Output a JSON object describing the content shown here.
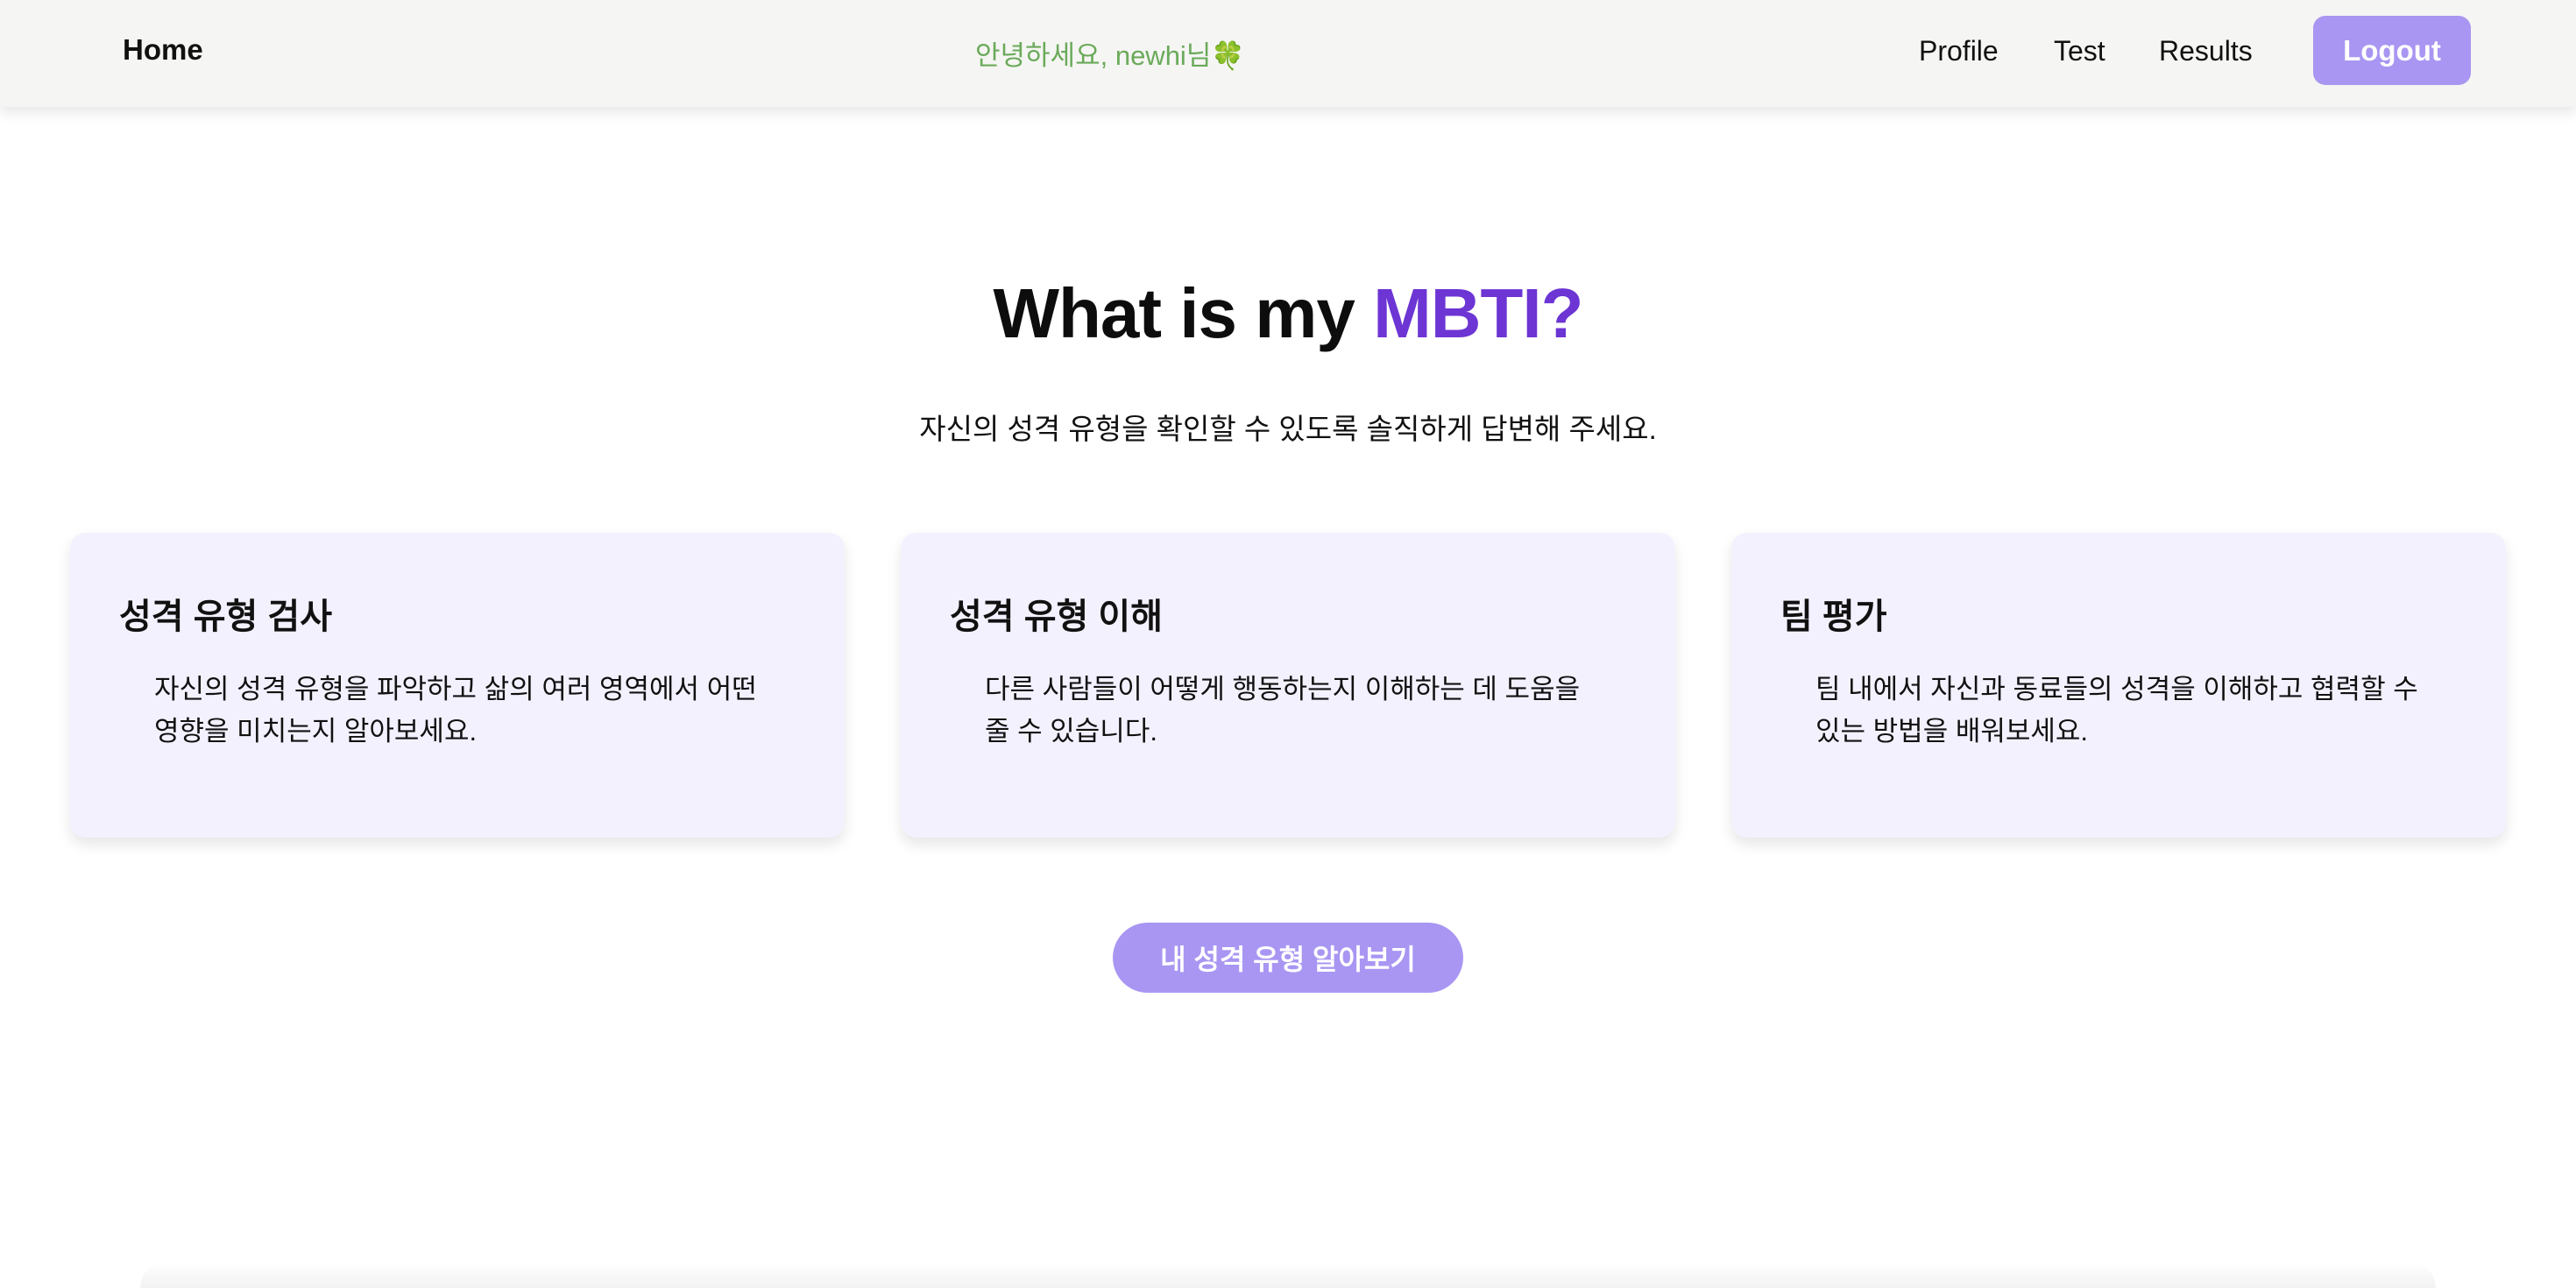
{
  "nav": {
    "home_label": "Home",
    "greeting": "안녕하세요, newhi님🍀",
    "links": [
      "Profile",
      "Test",
      "Results"
    ],
    "logout_label": "Logout"
  },
  "hero": {
    "title_prefix": "What is my ",
    "title_accent": "MBTI?",
    "subtitle": "자신의 성격 유형을 확인할 수 있도록 솔직하게 답변해 주세요."
  },
  "cards": [
    {
      "title": "성격 유형 검사",
      "description": "자신의 성격 유형을 파악하고 삶의 여러 영역에서 어떤 영향을 미치는지 알아보세요."
    },
    {
      "title": "성격 유형 이해",
      "description": "다른 사람들이 어떻게 행동하는지 이해하는 데 도움을 줄 수 있습니다."
    },
    {
      "title": "팀 평가",
      "description": "팀 내에서 자신과 동료들의 성격을 이해하고 협력할 수 있는 방법을 배워보세요."
    }
  ],
  "cta": {
    "label": "내 성격 유형 알아보기"
  },
  "colors": {
    "accent": "#6c35d4",
    "button": "#a996f2",
    "greeting": "#6aaa5a",
    "navbar_bg": "#f5f5f3",
    "card_bg": "#f3f1fe"
  }
}
